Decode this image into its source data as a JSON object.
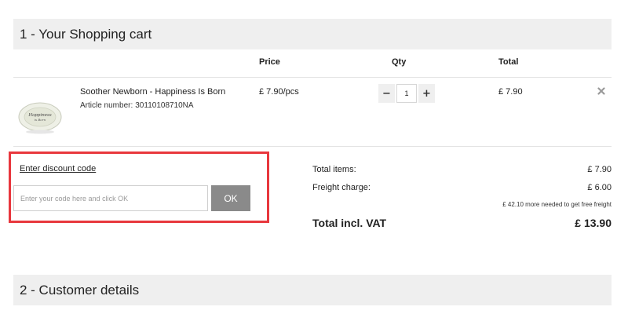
{
  "cart": {
    "title": "1 - Your Shopping cart",
    "columns": {
      "price": "Price",
      "qty": "Qty",
      "total": "Total"
    },
    "item": {
      "name": "Soother Newborn - Happiness Is Born",
      "article_label": "Article number:",
      "article_number": "30110108710NA",
      "price": "£ 7.90/pcs",
      "qty_value": "1",
      "qty_minus": "−",
      "qty_plus": "+",
      "total": "£ 7.90",
      "remove_icon": "close-icon",
      "image_text": "Happiness is Born"
    }
  },
  "discount": {
    "link_label": "Enter discount code",
    "placeholder": "Enter your code here and click OK",
    "value": "",
    "ok_label": "OK"
  },
  "summary": {
    "items_label": "Total items:",
    "items_value": "£ 7.90",
    "freight_label": "Freight charge:",
    "freight_value": "£ 6.00",
    "freight_note": "£ 42.10 more needed to get free freight",
    "total_label": "Total incl. VAT",
    "total_value": "£ 13.90"
  },
  "customer": {
    "title": "2 - Customer details"
  },
  "colors": {
    "header_bg": "#efefef",
    "highlight": "#e8373d",
    "ok_button": "#8a8a8a"
  }
}
